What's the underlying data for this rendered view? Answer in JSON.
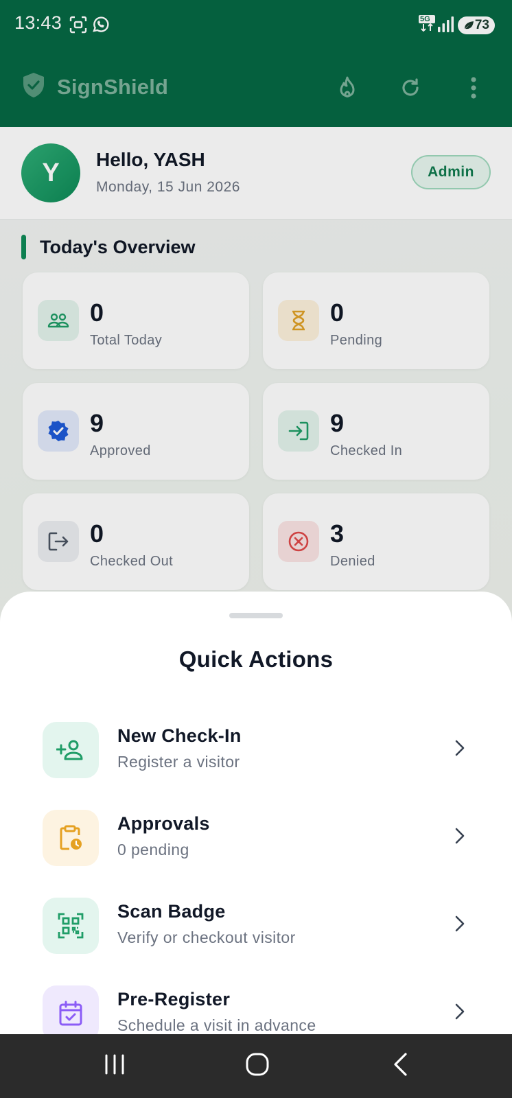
{
  "status_bar": {
    "time": "13:43",
    "network": "5G",
    "battery": "73",
    "icons": [
      "screenshot-icon",
      "whatsapp-icon",
      "signal-icon",
      "battery-icon"
    ]
  },
  "app_bar": {
    "title": "SignShield",
    "actions": [
      "flame-icon",
      "refresh-icon",
      "more-vert-icon"
    ],
    "color": "#066944"
  },
  "profile": {
    "initial": "Y",
    "greeting": "Hello, YASH",
    "date": "Monday, 15 Jun 2026",
    "role": "Admin"
  },
  "overview": {
    "title": "Today's Overview",
    "cards": [
      {
        "value": "0",
        "label": "Total Today",
        "icon": "people-icon",
        "color": "#1f9d67"
      },
      {
        "value": "0",
        "label": "Pending",
        "icon": "hourglass-icon",
        "color": "#e0a126"
      },
      {
        "value": "9",
        "label": "Approved",
        "icon": "verified-badge-icon",
        "color": "#1e5bd8"
      },
      {
        "value": "9",
        "label": "Checked In",
        "icon": "login-icon",
        "color": "#1f9d67"
      },
      {
        "value": "0",
        "label": "Checked Out",
        "icon": "logout-icon",
        "color": "#4b5563"
      },
      {
        "value": "3",
        "label": "Denied",
        "icon": "cancel-icon",
        "color": "#e04848"
      }
    ]
  },
  "quick_actions": {
    "title": "Quick Actions",
    "items": [
      {
        "title": "New Check-In",
        "subtitle": "Register a visitor",
        "icon": "person-add-icon",
        "color": "#1f9d67"
      },
      {
        "title": "Approvals",
        "subtitle": "0 pending",
        "icon": "clipboard-clock-icon",
        "color": "#e5a122"
      },
      {
        "title": "Scan Badge",
        "subtitle": "Verify or checkout visitor",
        "icon": "qr-scan-icon",
        "color": "#1f9d67"
      },
      {
        "title": "Pre-Register",
        "subtitle": "Schedule a visit in advance",
        "icon": "calendar-check-icon",
        "color": "#8b5cf6"
      }
    ]
  },
  "system_nav": [
    "recents-icon",
    "home-icon",
    "back-icon"
  ]
}
